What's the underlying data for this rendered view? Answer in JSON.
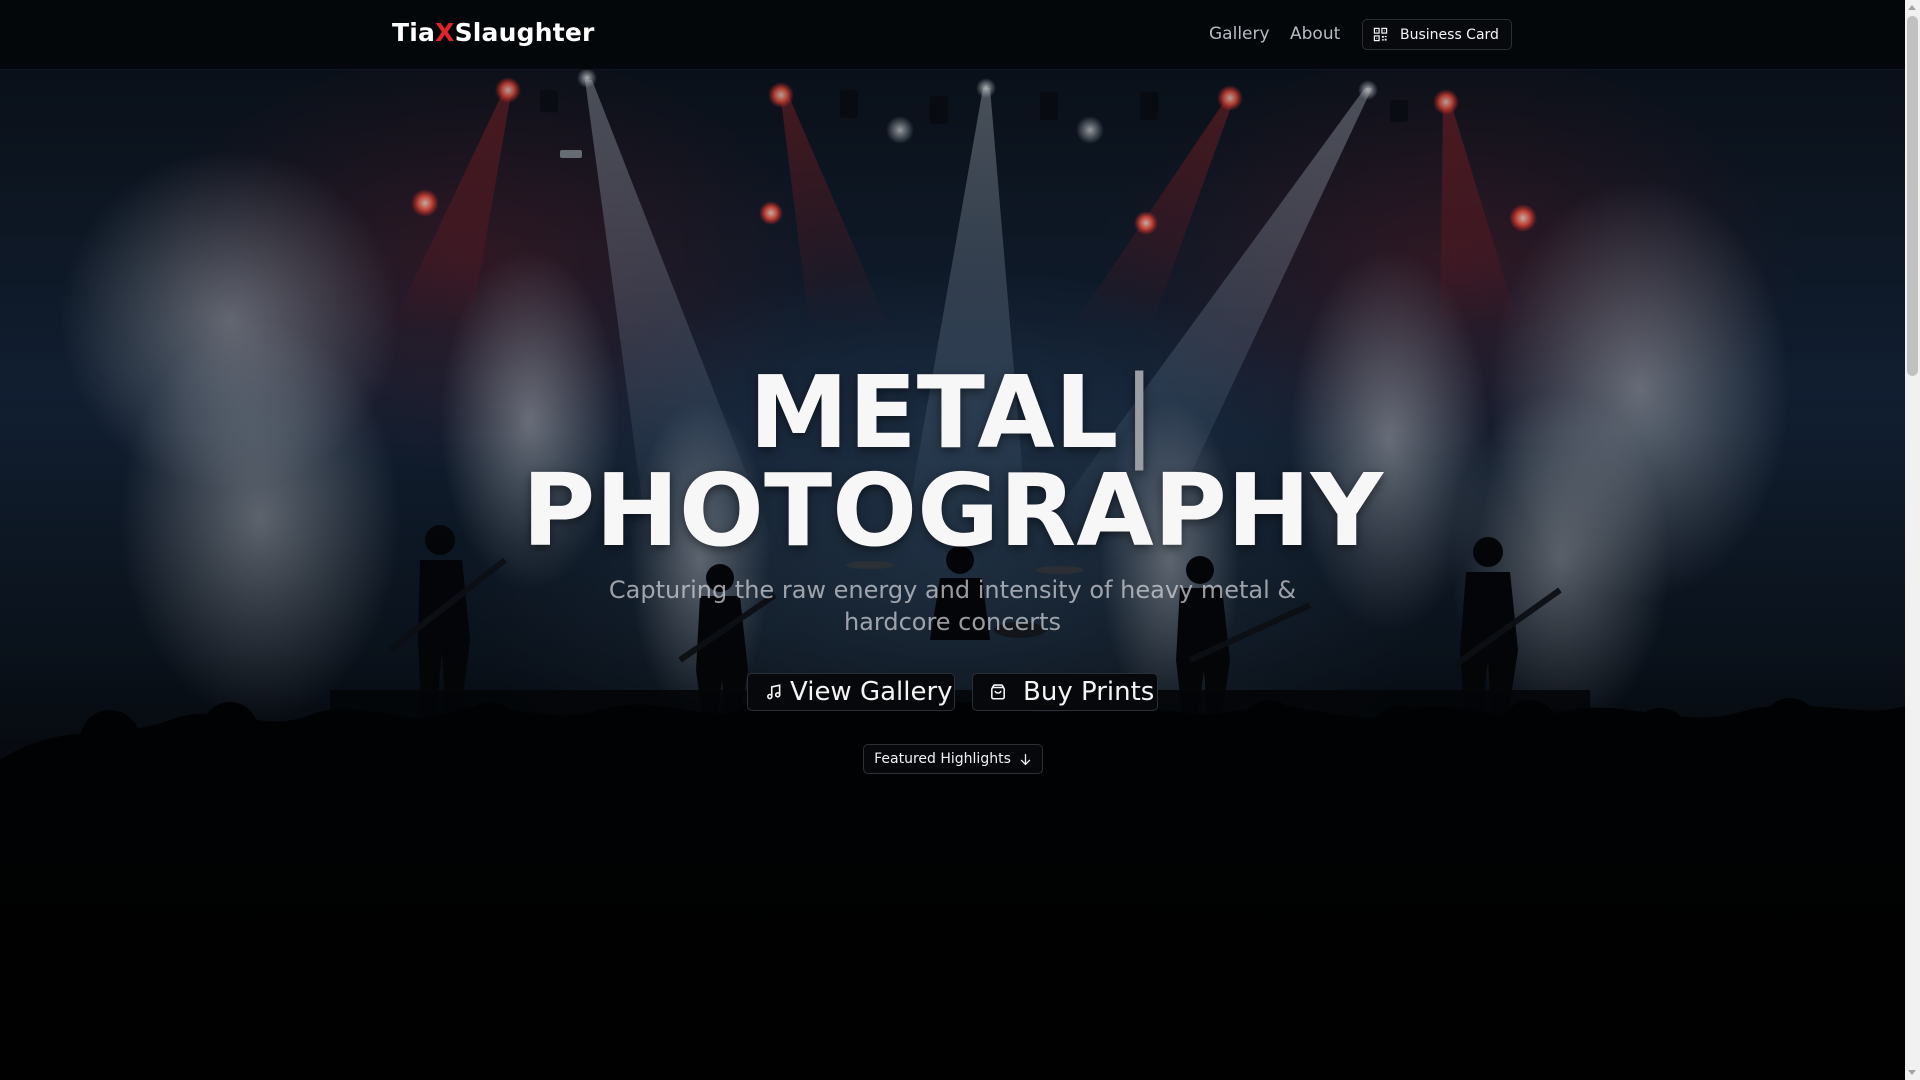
{
  "nav": {
    "brand": {
      "part1": "Tia",
      "part2": "X",
      "part3": "Slaughter"
    },
    "links": [
      {
        "label": "Gallery"
      },
      {
        "label": "About"
      }
    ],
    "business_card": {
      "label": "Business Card",
      "icon": "qr-code-icon"
    }
  },
  "hero": {
    "headline_line1": "METAL",
    "cursor": "|",
    "headline_line2": "PHOTOGRAPHY",
    "subtitle": "Capturing the raw energy and intensity of heavy metal & hardcore concerts",
    "buttons": {
      "view_gallery": {
        "label": "View Gallery",
        "icon": "music-note-icon"
      },
      "buy_prints": {
        "label": "Buy Prints",
        "icon": "shopping-bag-icon"
      }
    },
    "featured": {
      "label": "Featured Highlights",
      "icon": "arrow-down-icon"
    }
  },
  "colors": {
    "accent": "#e0242c",
    "nav_background": "#04060a",
    "button_background": "#07080b",
    "text_muted": "#b7bcc4"
  }
}
